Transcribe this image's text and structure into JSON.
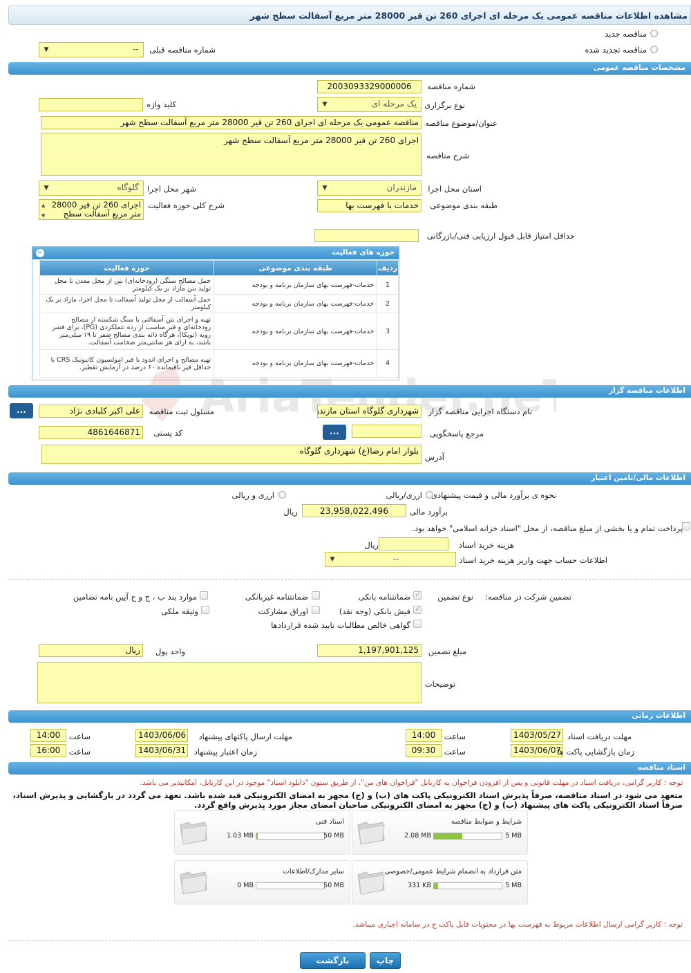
{
  "page_title": "مشاهده اطلاعات مناقصه عمومی یک مرحله ای اجرای 260 تن قیر 28000 متر مربع آسفالت سطح شهر",
  "tender_type": {
    "new_label": "مناقصه جدید",
    "renewed_label": "مناقصه تجدید شده",
    "previous_number_label": "شماره مناقصه قبلی",
    "previous_number_value": "--"
  },
  "general": {
    "section_title": "مشخصات مناقصه عمومی",
    "tender_number_label": "شماره مناقصه",
    "tender_number": "2003093329000006",
    "holding_type_label": "نوع برگزاری",
    "holding_type": "یک مرحله ای",
    "keyword_label": "کلید واژه",
    "keyword": "",
    "subject_label": "عنوان/موضوع مناقصه",
    "subject": "مناقصه عمومی یک مرحله ای اجرای 260 تن قیر 28000 متر مربع آسفالت سطح شهر",
    "description_label": "شرح مناقصه",
    "description": "اجرای 260 تن قیر 28000 متر مربع آسفالت سطح شهر",
    "province_label": "استان محل اجرا",
    "province": "مازندران",
    "city_label": "شهر محل اجرا",
    "city": "گلوگاه",
    "category_label": "طبقه بندی موضوعی",
    "category": "خدمات با فهرست بها",
    "scope_label": "شرح کلی حوزه فعالیت",
    "scope": "اجرای 260 تن قیر 28000 متر مربع آسفالت سطح",
    "min_score_label": "حداقل امتیاز قابل قبول ارزیابی فنی/بازرگانی",
    "min_score": ""
  },
  "activities": {
    "title": "حوزه های فعالیت",
    "headers": [
      "ردیف",
      "طبقه بندی موضوعی",
      "حوزه فعالیت"
    ],
    "rows": [
      {
        "num": "1",
        "category": "خدمات-فهرست بهای سازمان برنامه و بودجه",
        "area": "حمل مصالح سنگی (رودخانه‌ای) بتن از محل معدن تا محل تولید بتن مازاد بر یک کیلومتر"
      },
      {
        "num": "2",
        "category": "خدمات-فهرست بهای سازمان برنامه و بودجه",
        "area": "حمل آسفالت از محل تولید آسفالت تا محل اجرا، مازاد بر یک کیلومتر"
      },
      {
        "num": "3",
        "category": "خدمات-فهرست بهای سازمان برنامه و بودجه",
        "area": "تهیه و اجرای بتن آسفالتی با سنگ شکسته از مصالح رودخانه‌ای و قیر مناسب از رده عملکردی (PG)، برای قشر رویه (توپکا)، هرگاه دانه بندی مصالح صفر تا ۱۹ میلی‌متر باشد، به ازای هر سانتی‌متر ضخامت آسفالت."
      },
      {
        "num": "4",
        "category": "خدمات-فهرست بهای سازمان برنامه و بودجه",
        "area": "تهیه مصالح و اجرای اندود با قیر امولسیون کاتیونیک CRS با حداقل قیر باقیمانده ۶۰ درصد در آزمایش تقطیر."
      }
    ]
  },
  "organizer": {
    "section_title": "اطلاعات مناقصه گزار",
    "agency_label": "نام دستگاه اجرایی مناقصه گزار",
    "agency": "شهرداری گلوگاه استان مازندران",
    "official_label": "مسئول ثبت مناقصه",
    "official": "علی اکبر کلبادی نژاد",
    "reference_label": "مرجع پاسخگویی",
    "reference": "",
    "postal_label": "کد پستی",
    "postal_code": "4861646871",
    "address_label": "آدرس",
    "address": "بلوار امام رضا(ع) شهرداری گلوگاه",
    "more_label": "..."
  },
  "financial": {
    "section_title": "اطلاعات مالی/تامین اعتبار",
    "method_label": "نحوه ی برآورد مالی و قیمت پیشنهادی",
    "opt_rial": "ارزی/ریالی",
    "opt_both": "ارزی و ریالی",
    "estimate_label": "برآورد مالی",
    "estimate": "23,958,022,496",
    "rial_unit": "ریال",
    "treasury_text": "پرداخت تمام و یا بخشی از مبلغ مناقصه، از محل \"اسناد خزانه اسلامی\" خواهد بود.",
    "doc_fee_label": "هزینه خرید اسناد",
    "doc_fee": "",
    "account_label": "اطلاعات حساب جهت واریز هزینه خرید اسناد",
    "account_value": "--"
  },
  "guarantee": {
    "participation_label": "تضمین شرکت در مناقصه:",
    "type_label": "نوع تضمین",
    "options": {
      "bank_guarantee": "ضمانتنامه بانکی",
      "non_bank_guarantee": "ضمانتنامه غیربانکی",
      "clauses": "موارد بند ب ، ج و ح آیین نامه تضامین",
      "bank_receipt": "فیش بانکی (وجه نقد)",
      "bonds": "اوراق مشارکت",
      "property": "وثیقه ملکی",
      "claims_cert": "گواهی خالص مطالبات تایید شده قراردادها"
    },
    "amount_label": "مبلغ تضمین",
    "amount": "1,197,901,125",
    "currency_label": "واحد پول",
    "currency": "ریال",
    "notes_label": "توضیحات",
    "notes": ""
  },
  "timing": {
    "section_title": "اطلاعات زمانی",
    "doc_receive_label": "مهلت دریافت اسناد",
    "doc_receive_date": "1403/05/27",
    "doc_receive_time": "14:00",
    "send_label": "مهلت ارسال پاکتهای پیشنهاد",
    "send_date": "1403/06/06",
    "send_time": "14:00",
    "open_label": "زمان بازگشایی پاکت ها",
    "open_date": "1403/06/07",
    "open_time": "09:30",
    "validity_label": "زمان اعتبار پیشنهاد",
    "validity_date": "1403/06/31",
    "validity_time": "16:00",
    "time_label": "ساعت"
  },
  "documents": {
    "section_title": "اسناد مناقصه",
    "note1": "توجه : کاربر گرامی، دریافت اسناد در مهلت قانونی و پس از افزودن فراخوان به کارتابل \"فراخوان های من\"، از طریق ستون \"دانلود اسناد\" موجود در این کارتابل، امکانپذیر می باشد.",
    "note2_line1": "متعهد می شود در اسناد مناقصه، صرفاً پذیرش اسناد الکترونیکی پاکت های (ب) و (ج) مجهز به امضای الکترونیکی قید شده باشد. تعهد می گردد در بازگشایی و پذیرش اسناد،",
    "note2_line2": "صرفاً اسناد الکترونیکی پاکت های پیشنهاد (ب) و (ج) مجهز به امضای الکترونیکی صاحبان امضای مجاز مورد پذیرش واقع گردد.",
    "files": [
      {
        "name": "شرایط و ضوابط مناقصه",
        "size": "2.08 MB",
        "max": "5 MB",
        "fraction": 0.42
      },
      {
        "name": "اسناد فنی",
        "size": "1.03 MB",
        "max": "50 MB",
        "fraction": 0.02
      },
      {
        "name": "متن قرارداد به انضمام شرایط عمومی/خصوصی",
        "size": "331 KB",
        "max": "5 MB",
        "fraction": 0.06
      },
      {
        "name": "سایر مدارک/اطلاعات",
        "size": "0 MB",
        "max": "50 MB",
        "fraction": 0.0
      }
    ],
    "note3": "توجه : کاربر گرامی ارسال اطلاعات مربوط به فهرست بها در محتویات فایل پاکت ج در سامانه اجباری میباشد."
  },
  "footer": {
    "print_label": "چاپ",
    "back_label": "بازگشت"
  },
  "watermark_text": "AriaTender.neT"
}
